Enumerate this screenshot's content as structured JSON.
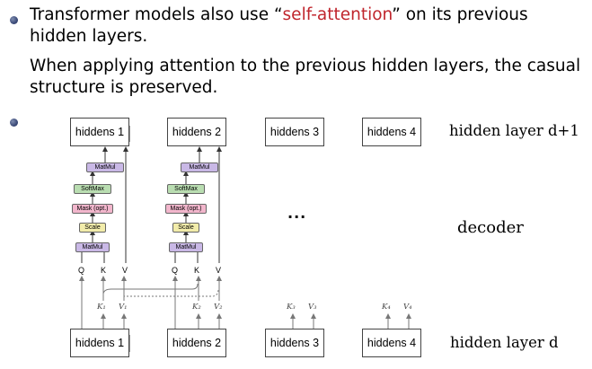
{
  "bullets": [
    {
      "pre": "Transformer models also use “",
      "highlight": "self-attention",
      "post": "” on its previous hidden layers."
    },
    {
      "pre": "When applying attention to the previous hidden layers, the casual structure is preserved.",
      "highlight": "",
      "post": ""
    }
  ],
  "figure": {
    "top_boxes": [
      "hiddens 1",
      "hiddens 2",
      "hiddens 3",
      "hiddens 4"
    ],
    "bottom_boxes": [
      "hiddens 1",
      "hiddens 2",
      "hiddens 3",
      "hiddens 4"
    ],
    "ops": {
      "matmul": "MatMul",
      "softmax": "SoftMax",
      "mask": "Mask (opt.)",
      "scale": "Scale"
    },
    "qkv": {
      "q": "Q",
      "k": "K",
      "v": "V"
    },
    "kv_labels": [
      {
        "k": "K₁",
        "v": "V₁"
      },
      {
        "k": "K₂",
        "v": "V₂"
      },
      {
        "k": "K₃",
        "v": "V₃"
      },
      {
        "k": "K₄",
        "v": "V₄"
      }
    ],
    "ellipsis": "···",
    "side_labels": {
      "top": "hidden layer d+1",
      "middle": "decoder",
      "bottom": "hidden layer d"
    }
  }
}
